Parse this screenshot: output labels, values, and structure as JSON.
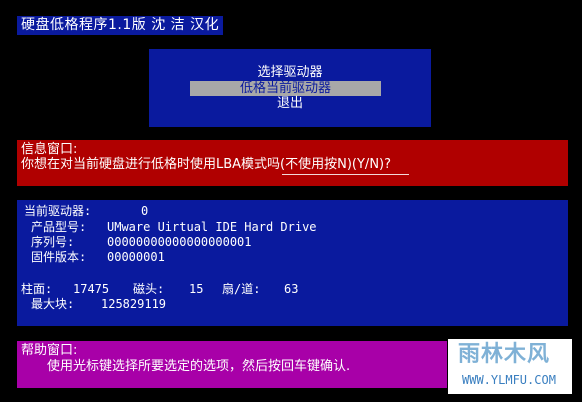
{
  "title": "硬盘低格程序1.1版 沈 洁 汉化",
  "menu": {
    "items": [
      {
        "label": "选择驱动器",
        "selected": false
      },
      {
        "label": "低格当前驱动器",
        "selected": true
      },
      {
        "label": "退出",
        "selected": false
      }
    ]
  },
  "info": {
    "title": "信息窗口:",
    "message": "你想在对当前硬盘进行低格时使用LBA模式吗(不使用按N)(Y/N)?"
  },
  "drive": {
    "current_label": "当前驱动器:",
    "current_value": "0",
    "model_label": "产品型号:",
    "model_value": "UMware Uirtual IDE Hard Drive",
    "serial_label": "序列号:",
    "serial_value": "00000000000000000001",
    "firmware_label": "固件版本:",
    "firmware_value": "00000001",
    "cyl_label": "柱面:",
    "cyl_value": "17475",
    "heads_label": "磁头:",
    "heads_value": "15",
    "sectors_label": "扇/道:",
    "sectors_value": "63",
    "maxblock_label": "最大块:",
    "maxblock_value": "125829119"
  },
  "help": {
    "title": "帮助窗口:",
    "text": "使用光标键选择所要选定的选项，然后按回车键确认."
  },
  "watermark": {
    "main": "雨林木风",
    "sub": "WWW.YLMFU.COM"
  },
  "colors": {
    "blue_panel": "#0a1a9e",
    "red_panel": "#b00000",
    "magenta_panel": "#a800a8",
    "selection": "#a8a8a8"
  }
}
